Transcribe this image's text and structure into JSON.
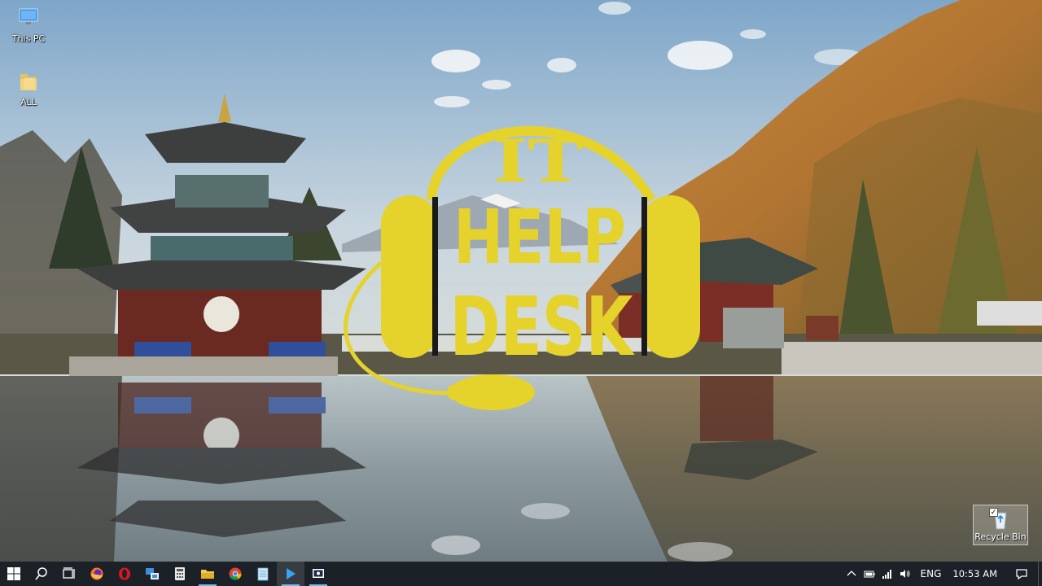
{
  "desktop": {
    "icons": [
      {
        "label": "This PC",
        "icon": "computer-icon"
      },
      {
        "label": "ALL",
        "icon": "folder-icon"
      }
    ],
    "recycle_bin": {
      "label": "Recycle Bin",
      "icon": "recycle-bin-icon"
    }
  },
  "logo": {
    "line1": "IT",
    "line2": "HELP",
    "line3": "DESK",
    "color": "#e5d22b"
  },
  "taskbar": {
    "apps": [
      {
        "name": "start",
        "icon": "windows-icon"
      },
      {
        "name": "search",
        "icon": "search-icon"
      },
      {
        "name": "task-view",
        "icon": "task-view-icon"
      },
      {
        "name": "firefox",
        "icon": "firefox-icon"
      },
      {
        "name": "opera",
        "icon": "opera-icon"
      },
      {
        "name": "remote-desktop",
        "icon": "remote-desktop-icon"
      },
      {
        "name": "calculator",
        "icon": "calculator-icon"
      },
      {
        "name": "file-explorer",
        "icon": "folder-icon"
      },
      {
        "name": "chrome",
        "icon": "chrome-icon"
      },
      {
        "name": "notepad",
        "icon": "notepad-icon"
      },
      {
        "name": "media-player",
        "icon": "play-icon"
      },
      {
        "name": "screen-app",
        "icon": "screen-icon"
      }
    ],
    "tray": {
      "language": "ENG",
      "time": "10:53 AM"
    }
  }
}
